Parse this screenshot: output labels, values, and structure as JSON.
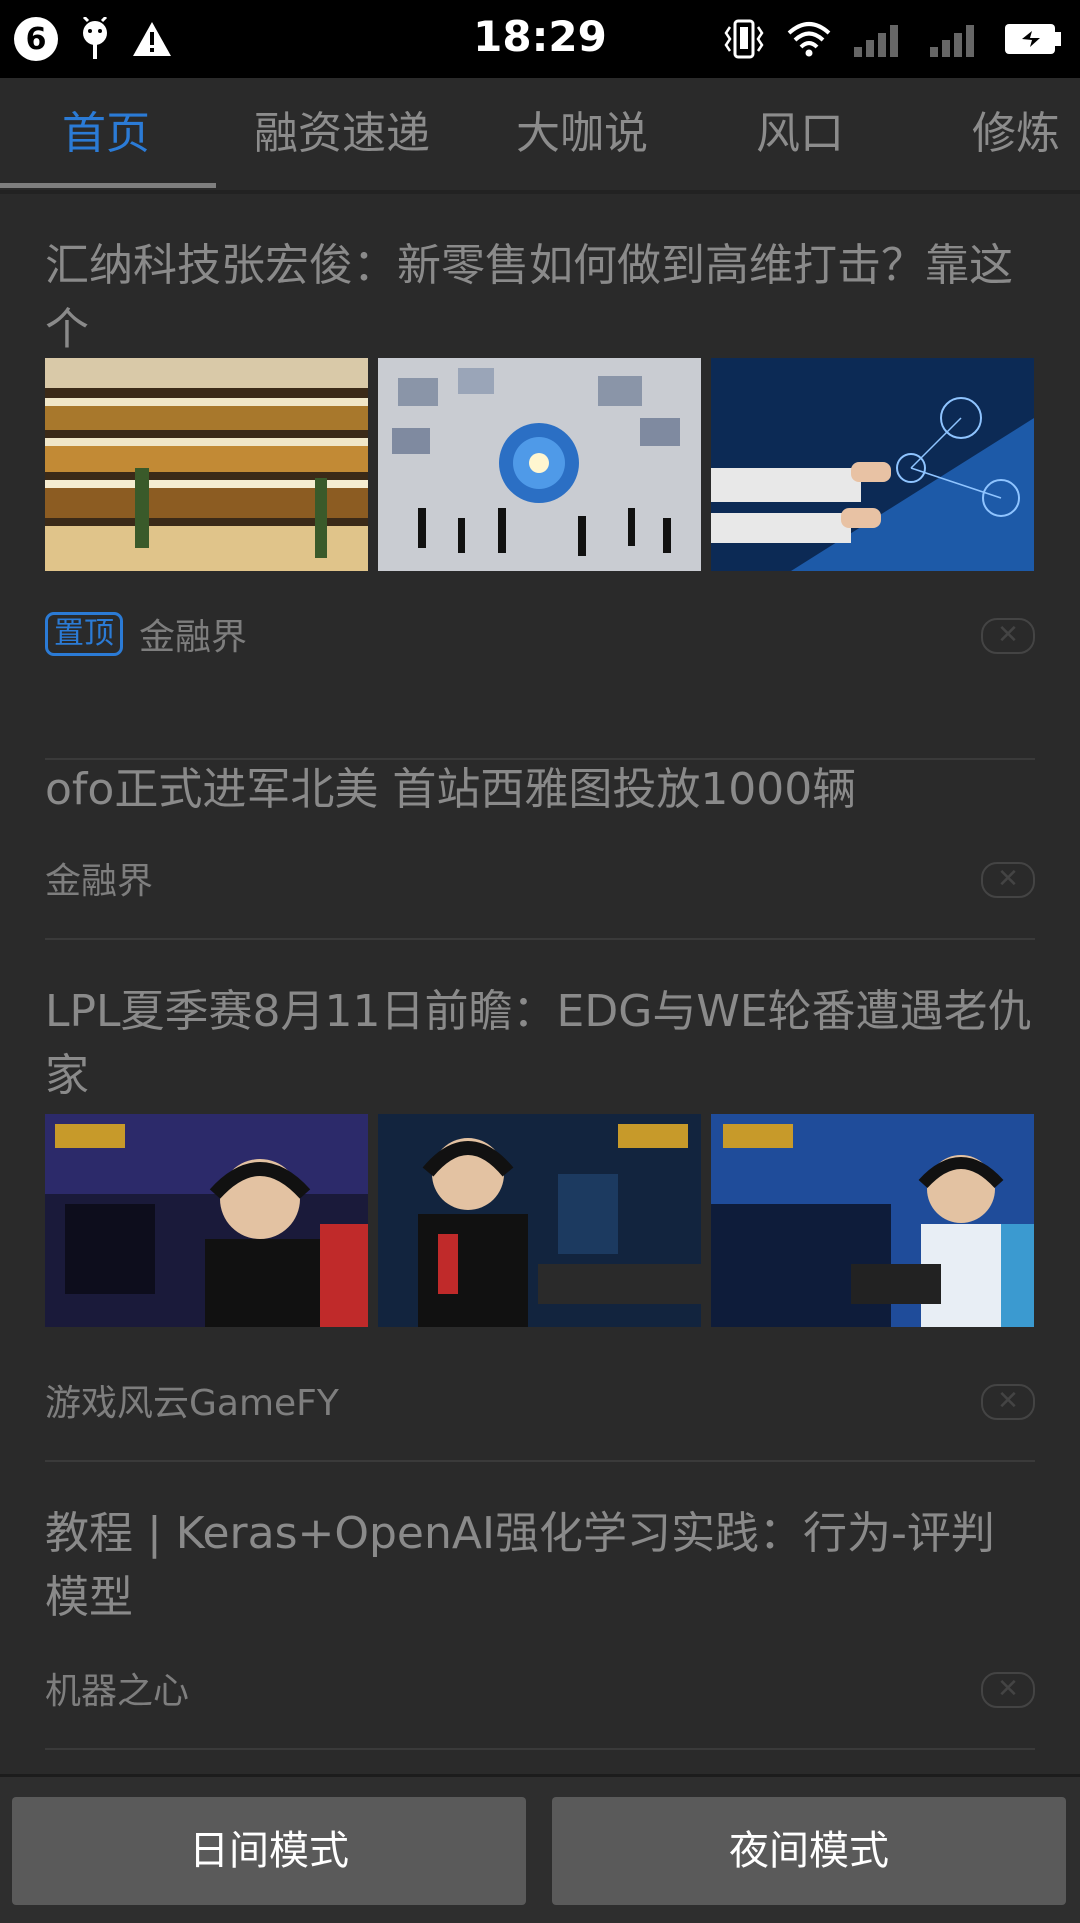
{
  "status_bar": {
    "notification_count": "6",
    "time": "18:29"
  },
  "tabs": [
    {
      "label": "首页",
      "active": true
    },
    {
      "label": "融资速递",
      "active": false
    },
    {
      "label": "大咖说",
      "active": false
    },
    {
      "label": "风口",
      "active": false
    },
    {
      "label": "修炼",
      "active": false
    }
  ],
  "articles": [
    {
      "title": "汇纳科技张宏俊：新零售如何做到高维打击？靠这个",
      "pinned_label": "置顶",
      "source": "金融界",
      "close": "✕"
    },
    {
      "title": "ofo正式进军北美 首站西雅图投放1000辆",
      "source": "金融界",
      "close": "✕"
    },
    {
      "title": "LPL夏季赛8月11日前瞻：EDG与WE轮番遭遇老仇家",
      "source": "游戏风云GameFY",
      "close": "✕"
    },
    {
      "title": " 教程 | Keras+OpenAI强化学习实践：行为-评判模型",
      "source": "机器之心",
      "close": "✕"
    }
  ],
  "mode_bar": {
    "day_mode": "日间模式",
    "night_mode": "夜间模式"
  },
  "colors": {
    "accent": "#2b7bd6",
    "background": "#2a2a2a",
    "status_bar": "#000000"
  }
}
